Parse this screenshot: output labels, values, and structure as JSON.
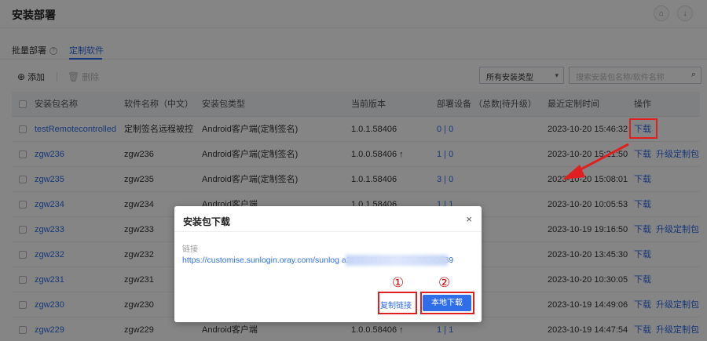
{
  "header": {
    "title": "安装部署"
  },
  "tabs": [
    {
      "label": "批量部署"
    },
    {
      "label": "定制软件"
    }
  ],
  "toolbar": {
    "add_label": "添加",
    "delete_label": "删除",
    "type_select_value": "所有安装类型",
    "search_placeholder": "搜索安装包名称/软件名称"
  },
  "table": {
    "columns": [
      "安装包名称",
      "软件名称（中文）",
      "安装包类型",
      "当前版本",
      "部署设备 （总数|待升级）",
      "最近定制时间",
      "操作"
    ],
    "rows": [
      {
        "name": "testRemotecontrolled",
        "cn_name": "定制签名远程被控",
        "type": "Android客户端(定制签名)",
        "version": "1.0.1.58406",
        "devices": "0 | 0",
        "time": "2023-10-20 15:46:32",
        "op1": "下载",
        "op2": ""
      },
      {
        "name": "zgw236",
        "cn_name": "zgw236",
        "type": "Android客户端(定制签名)",
        "version": "1.0.0.58406 ↑",
        "devices": "1 | 0",
        "time": "2023-10-20 15:21:50",
        "op1": "下载",
        "op2": "升级定制包"
      },
      {
        "name": "zgw235",
        "cn_name": "zgw235",
        "type": "Android客户端(定制签名)",
        "version": "1.0.1.58406",
        "devices": "3 | 0",
        "time": "2023-10-20 15:08:01",
        "op1": "下载",
        "op2": ""
      },
      {
        "name": "zgw234",
        "cn_name": "zgw234",
        "type": "Android客户端",
        "version": "1.0.1.58406",
        "devices": "1 | 1",
        "time": "2023-10-20 10:05:53",
        "op1": "下载",
        "op2": ""
      },
      {
        "name": "zgw233",
        "cn_name": "zgw233",
        "type": "",
        "version": "",
        "devices": "",
        "time": "2023-10-19 19:16:50",
        "op1": "下载",
        "op2": "升级定制包"
      },
      {
        "name": "zgw232",
        "cn_name": "zgw232",
        "type": "",
        "version": "",
        "devices": "",
        "time": "2023-10-20 13:45:30",
        "op1": "下载",
        "op2": ""
      },
      {
        "name": "zgw231",
        "cn_name": "zgw231",
        "type": "",
        "version": "",
        "devices": "",
        "time": "2023-10-20 10:30:05",
        "op1": "下载",
        "op2": ""
      },
      {
        "name": "zgw230",
        "cn_name": "zgw230",
        "type": "",
        "version": "",
        "devices": "",
        "time": "2023-10-19 14:49:06",
        "op1": "下载",
        "op2": "升级定制包"
      },
      {
        "name": "zgw229",
        "cn_name": "zgw229",
        "type": "Android客户端",
        "version": "1.0.0.58406 ↑",
        "devices": "1 | 1",
        "time": "2023-10-19 14:47:54",
        "op1": "下载",
        "op2": "升级定制包"
      }
    ]
  },
  "modal": {
    "title": "安装包下载",
    "close": "×",
    "link_label": "链接",
    "link_url": "https://customise.sunlogin.oray.com/sunlog                              a2948b81b272d97fc572b2ff39",
    "copy_label": "复制链接",
    "local_label": "本地下载"
  },
  "annotations": {
    "marker1": "①",
    "marker2": "②"
  },
  "colors": {
    "accent": "#2f6ee8",
    "highlight": "#e02020"
  }
}
